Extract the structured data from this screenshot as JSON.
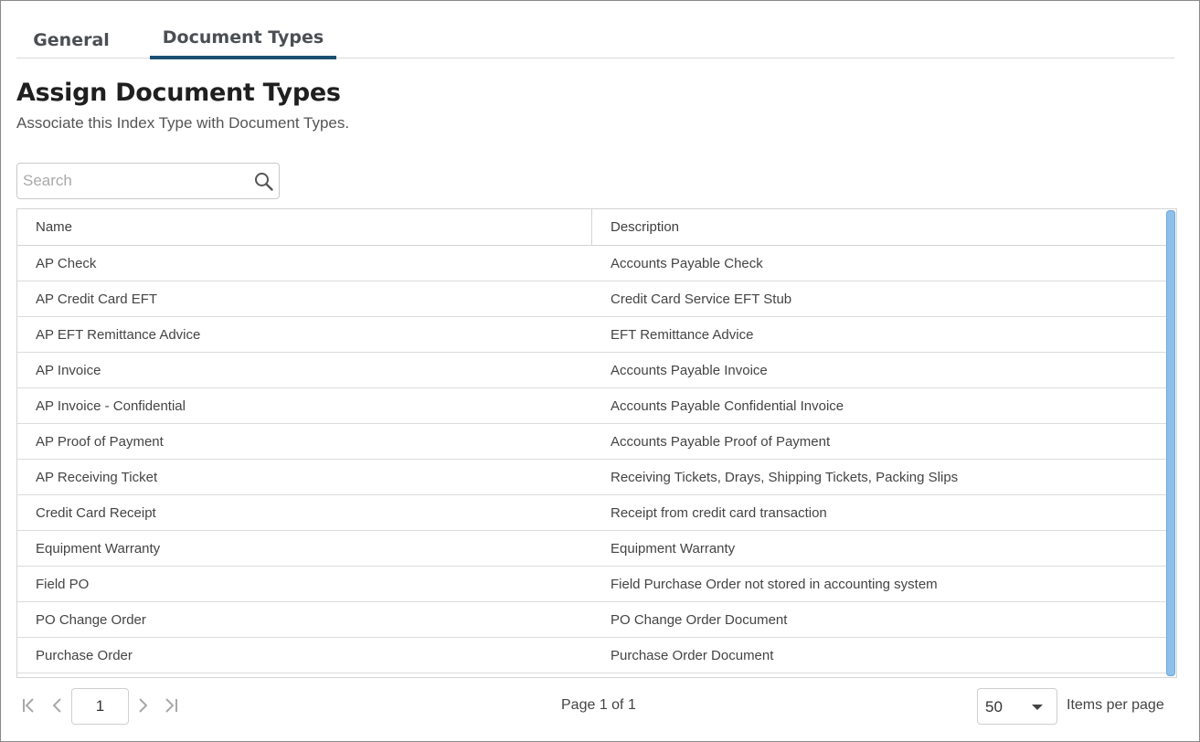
{
  "tabs": [
    {
      "label": "General",
      "active": false
    },
    {
      "label": "Document Types",
      "active": true
    }
  ],
  "header": {
    "title": "Assign Document Types",
    "subtitle": "Associate this Index Type with Document Types."
  },
  "search": {
    "placeholder": "Search",
    "value": ""
  },
  "table": {
    "columns": [
      "Name",
      "Description"
    ],
    "rows": [
      {
        "name": "AP Check",
        "description": "Accounts Payable Check"
      },
      {
        "name": "AP Credit Card EFT",
        "description": "Credit Card Service EFT Stub"
      },
      {
        "name": "AP EFT Remittance Advice",
        "description": "EFT Remittance Advice"
      },
      {
        "name": "AP Invoice",
        "description": "Accounts Payable Invoice"
      },
      {
        "name": "AP Invoice - Confidential",
        "description": "Accounts Payable Confidential Invoice"
      },
      {
        "name": "AP Proof of Payment",
        "description": "Accounts Payable Proof of Payment"
      },
      {
        "name": "AP Receiving Ticket",
        "description": "Receiving Tickets, Drays, Shipping Tickets, Packing Slips"
      },
      {
        "name": "Credit Card Receipt",
        "description": "Receipt from credit card transaction"
      },
      {
        "name": "Equipment Warranty",
        "description": "Equipment Warranty"
      },
      {
        "name": "Field PO",
        "description": "Field Purchase Order not stored in accounting system"
      },
      {
        "name": "PO Change Order",
        "description": "PO Change Order Document"
      },
      {
        "name": "Purchase Order",
        "description": "Purchase Order Document"
      }
    ]
  },
  "pager": {
    "current_page": "1",
    "page_info": "Page 1 of 1",
    "items_per_page": "50",
    "items_per_page_label": "Items per page"
  },
  "colors": {
    "active_tab_underline": "#1d4f73",
    "scrollbar_thumb": "#8ec0ec"
  },
  "icons": [
    "search-icon",
    "first-page-icon",
    "previous-page-icon",
    "next-page-icon",
    "last-page-icon",
    "chevron-down-icon"
  ]
}
